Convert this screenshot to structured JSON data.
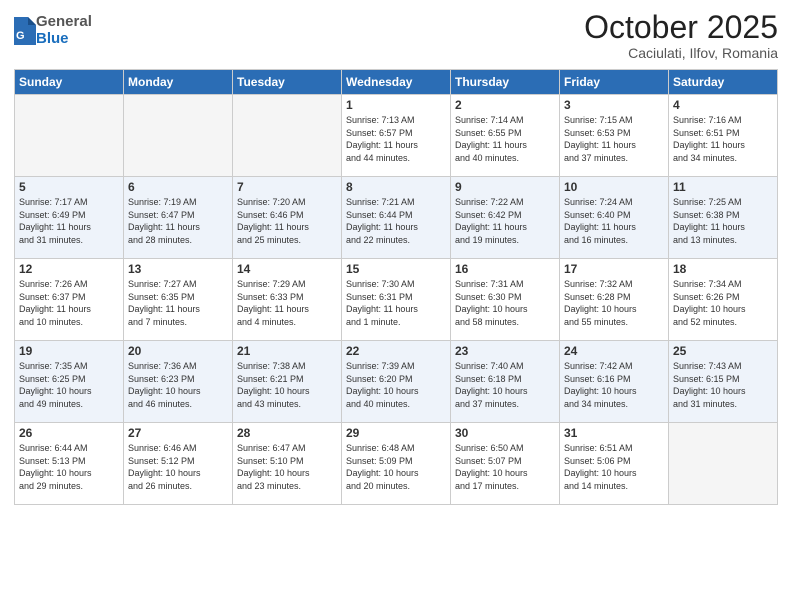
{
  "header": {
    "logo_general": "General",
    "logo_blue": "Blue",
    "month_title": "October 2025",
    "location": "Caciulati, Ilfov, Romania"
  },
  "weekdays": [
    "Sunday",
    "Monday",
    "Tuesday",
    "Wednesday",
    "Thursday",
    "Friday",
    "Saturday"
  ],
  "weeks": [
    [
      {
        "day": "",
        "info": ""
      },
      {
        "day": "",
        "info": ""
      },
      {
        "day": "",
        "info": ""
      },
      {
        "day": "1",
        "info": "Sunrise: 7:13 AM\nSunset: 6:57 PM\nDaylight: 11 hours\nand 44 minutes."
      },
      {
        "day": "2",
        "info": "Sunrise: 7:14 AM\nSunset: 6:55 PM\nDaylight: 11 hours\nand 40 minutes."
      },
      {
        "day": "3",
        "info": "Sunrise: 7:15 AM\nSunset: 6:53 PM\nDaylight: 11 hours\nand 37 minutes."
      },
      {
        "day": "4",
        "info": "Sunrise: 7:16 AM\nSunset: 6:51 PM\nDaylight: 11 hours\nand 34 minutes."
      }
    ],
    [
      {
        "day": "5",
        "info": "Sunrise: 7:17 AM\nSunset: 6:49 PM\nDaylight: 11 hours\nand 31 minutes."
      },
      {
        "day": "6",
        "info": "Sunrise: 7:19 AM\nSunset: 6:47 PM\nDaylight: 11 hours\nand 28 minutes."
      },
      {
        "day": "7",
        "info": "Sunrise: 7:20 AM\nSunset: 6:46 PM\nDaylight: 11 hours\nand 25 minutes."
      },
      {
        "day": "8",
        "info": "Sunrise: 7:21 AM\nSunset: 6:44 PM\nDaylight: 11 hours\nand 22 minutes."
      },
      {
        "day": "9",
        "info": "Sunrise: 7:22 AM\nSunset: 6:42 PM\nDaylight: 11 hours\nand 19 minutes."
      },
      {
        "day": "10",
        "info": "Sunrise: 7:24 AM\nSunset: 6:40 PM\nDaylight: 11 hours\nand 16 minutes."
      },
      {
        "day": "11",
        "info": "Sunrise: 7:25 AM\nSunset: 6:38 PM\nDaylight: 11 hours\nand 13 minutes."
      }
    ],
    [
      {
        "day": "12",
        "info": "Sunrise: 7:26 AM\nSunset: 6:37 PM\nDaylight: 11 hours\nand 10 minutes."
      },
      {
        "day": "13",
        "info": "Sunrise: 7:27 AM\nSunset: 6:35 PM\nDaylight: 11 hours\nand 7 minutes."
      },
      {
        "day": "14",
        "info": "Sunrise: 7:29 AM\nSunset: 6:33 PM\nDaylight: 11 hours\nand 4 minutes."
      },
      {
        "day": "15",
        "info": "Sunrise: 7:30 AM\nSunset: 6:31 PM\nDaylight: 11 hours\nand 1 minute."
      },
      {
        "day": "16",
        "info": "Sunrise: 7:31 AM\nSunset: 6:30 PM\nDaylight: 10 hours\nand 58 minutes."
      },
      {
        "day": "17",
        "info": "Sunrise: 7:32 AM\nSunset: 6:28 PM\nDaylight: 10 hours\nand 55 minutes."
      },
      {
        "day": "18",
        "info": "Sunrise: 7:34 AM\nSunset: 6:26 PM\nDaylight: 10 hours\nand 52 minutes."
      }
    ],
    [
      {
        "day": "19",
        "info": "Sunrise: 7:35 AM\nSunset: 6:25 PM\nDaylight: 10 hours\nand 49 minutes."
      },
      {
        "day": "20",
        "info": "Sunrise: 7:36 AM\nSunset: 6:23 PM\nDaylight: 10 hours\nand 46 minutes."
      },
      {
        "day": "21",
        "info": "Sunrise: 7:38 AM\nSunset: 6:21 PM\nDaylight: 10 hours\nand 43 minutes."
      },
      {
        "day": "22",
        "info": "Sunrise: 7:39 AM\nSunset: 6:20 PM\nDaylight: 10 hours\nand 40 minutes."
      },
      {
        "day": "23",
        "info": "Sunrise: 7:40 AM\nSunset: 6:18 PM\nDaylight: 10 hours\nand 37 minutes."
      },
      {
        "day": "24",
        "info": "Sunrise: 7:42 AM\nSunset: 6:16 PM\nDaylight: 10 hours\nand 34 minutes."
      },
      {
        "day": "25",
        "info": "Sunrise: 7:43 AM\nSunset: 6:15 PM\nDaylight: 10 hours\nand 31 minutes."
      }
    ],
    [
      {
        "day": "26",
        "info": "Sunrise: 6:44 AM\nSunset: 5:13 PM\nDaylight: 10 hours\nand 29 minutes."
      },
      {
        "day": "27",
        "info": "Sunrise: 6:46 AM\nSunset: 5:12 PM\nDaylight: 10 hours\nand 26 minutes."
      },
      {
        "day": "28",
        "info": "Sunrise: 6:47 AM\nSunset: 5:10 PM\nDaylight: 10 hours\nand 23 minutes."
      },
      {
        "day": "29",
        "info": "Sunrise: 6:48 AM\nSunset: 5:09 PM\nDaylight: 10 hours\nand 20 minutes."
      },
      {
        "day": "30",
        "info": "Sunrise: 6:50 AM\nSunset: 5:07 PM\nDaylight: 10 hours\nand 17 minutes."
      },
      {
        "day": "31",
        "info": "Sunrise: 6:51 AM\nSunset: 5:06 PM\nDaylight: 10 hours\nand 14 minutes."
      },
      {
        "day": "",
        "info": ""
      }
    ]
  ],
  "row_styles": [
    "row-white",
    "row-blue",
    "row-white",
    "row-blue",
    "row-white"
  ]
}
